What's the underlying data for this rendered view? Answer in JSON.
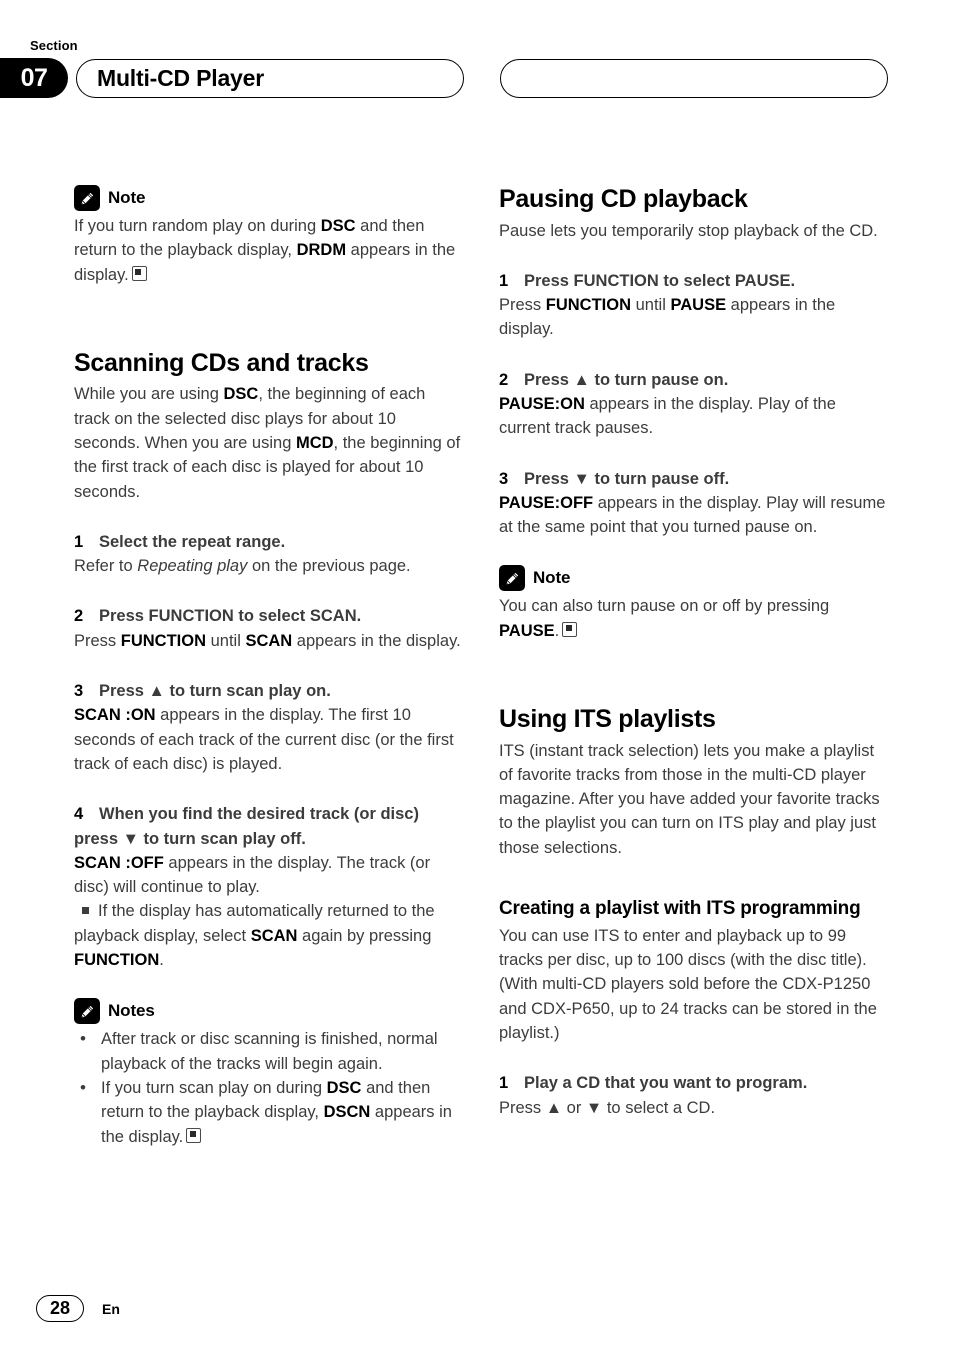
{
  "header": {
    "section_label": "Section",
    "section_number": "07",
    "title": "Multi-CD Player",
    "right_pill_text": ""
  },
  "footer": {
    "page_number": "28",
    "language": "En"
  },
  "left_column": {
    "note1": {
      "icon": "pencil-note-icon",
      "title": "Note",
      "body_prefix": "If you turn random play on during ",
      "body_bold1": "DSC",
      "body_mid": " and then return to the playback display, ",
      "body_bold2": "DRDM",
      "body_suffix": " appears in the display."
    },
    "heading": "Scanning CDs and tracks",
    "intro_1": "While you are using ",
    "intro_b1": "DSC",
    "intro_2": ", the beginning of each track on the selected disc plays for about 10 seconds. When you are using ",
    "intro_b2": "MCD",
    "intro_3": ", the beginning of the first track of each disc is played for about 10 seconds.",
    "steps": [
      {
        "num": "1",
        "title": "Select the repeat range.",
        "body_1": "Refer to ",
        "body_italic": "Repeating play",
        "body_2": " on the previous page."
      },
      {
        "num": "2",
        "title": "Press FUNCTION to select SCAN.",
        "body_1": "Press ",
        "body_b1": "FUNCTION",
        "body_2": " until ",
        "body_b2": "SCAN",
        "body_3": " appears in the display."
      },
      {
        "num": "3",
        "title": "Press ▲ to turn scan play on.",
        "body_b1": "SCAN :ON",
        "body_1": " appears in the display. The first 10 seconds of each track of the current disc (or the first track of each disc) is played."
      },
      {
        "num": "4",
        "title": "When you find the desired track (or disc) press ▼ to turn scan play off.",
        "body_b1": "SCAN :OFF",
        "body_1": " appears in the display. The track (or disc) will continue to play.",
        "sub_1": "If the display has automatically returned to the playback display, select ",
        "sub_b1": "SCAN",
        "sub_2": " again by pressing ",
        "sub_b2": "FUNCTION",
        "sub_3": "."
      }
    ],
    "notes2": {
      "icon": "pencil-note-icon",
      "title": "Notes",
      "items": [
        {
          "text_1": "After track or disc scanning is finished, normal playback of the tracks will begin again.",
          "bold_1": "",
          "text_2": "",
          "bold_2": "",
          "text_3": "",
          "endmark": false
        },
        {
          "text_1": "If you turn scan play on during ",
          "bold_1": "DSC",
          "text_2": " and then return to the playback display, ",
          "bold_2": "DSCN",
          "text_3": " appears in the display.",
          "endmark": true
        }
      ]
    }
  },
  "right_column": {
    "heading1": "Pausing CD playback",
    "intro1": "Pause lets you temporarily stop playback of the CD.",
    "steps1": [
      {
        "num": "1",
        "title": "Press FUNCTION to select PAUSE.",
        "body_1": "Press ",
        "body_b1": "FUNCTION",
        "body_2": " until ",
        "body_b2": "PAUSE",
        "body_3": " appears in the display."
      },
      {
        "num": "2",
        "title": "Press ▲ to turn pause on.",
        "body_b1": "PAUSE:ON",
        "body_1": " appears in the display. Play of the current track pauses."
      },
      {
        "num": "3",
        "title": "Press ▼ to turn pause off.",
        "body_b1": "PAUSE:OFF",
        "body_1": " appears in the display. Play will resume at the same point that you turned pause on."
      }
    ],
    "note1": {
      "icon": "pencil-note-icon",
      "title": "Note",
      "body_1": "You can also turn pause on or off by pressing ",
      "body_b1": "PAUSE",
      "body_2": "."
    },
    "heading2": "Using ITS playlists",
    "intro2": "ITS (instant track selection) lets you make a playlist of favorite tracks from those in the multi-CD player magazine. After you have added your favorite tracks to the playlist you can turn on ITS play and play just those selections.",
    "subheading": "Creating a playlist with ITS programming",
    "intro3": "You can use ITS to enter and playback up to 99 tracks per disc, up to 100 discs (with the disc title). (With multi-CD players sold before the CDX-P1250 and CDX-P650, up to 24 tracks can be stored in the playlist.)",
    "steps2": [
      {
        "num": "1",
        "title": "Play a CD that you want to program.",
        "body_1": "Press ▲ or ▼ to select a CD."
      }
    ]
  }
}
